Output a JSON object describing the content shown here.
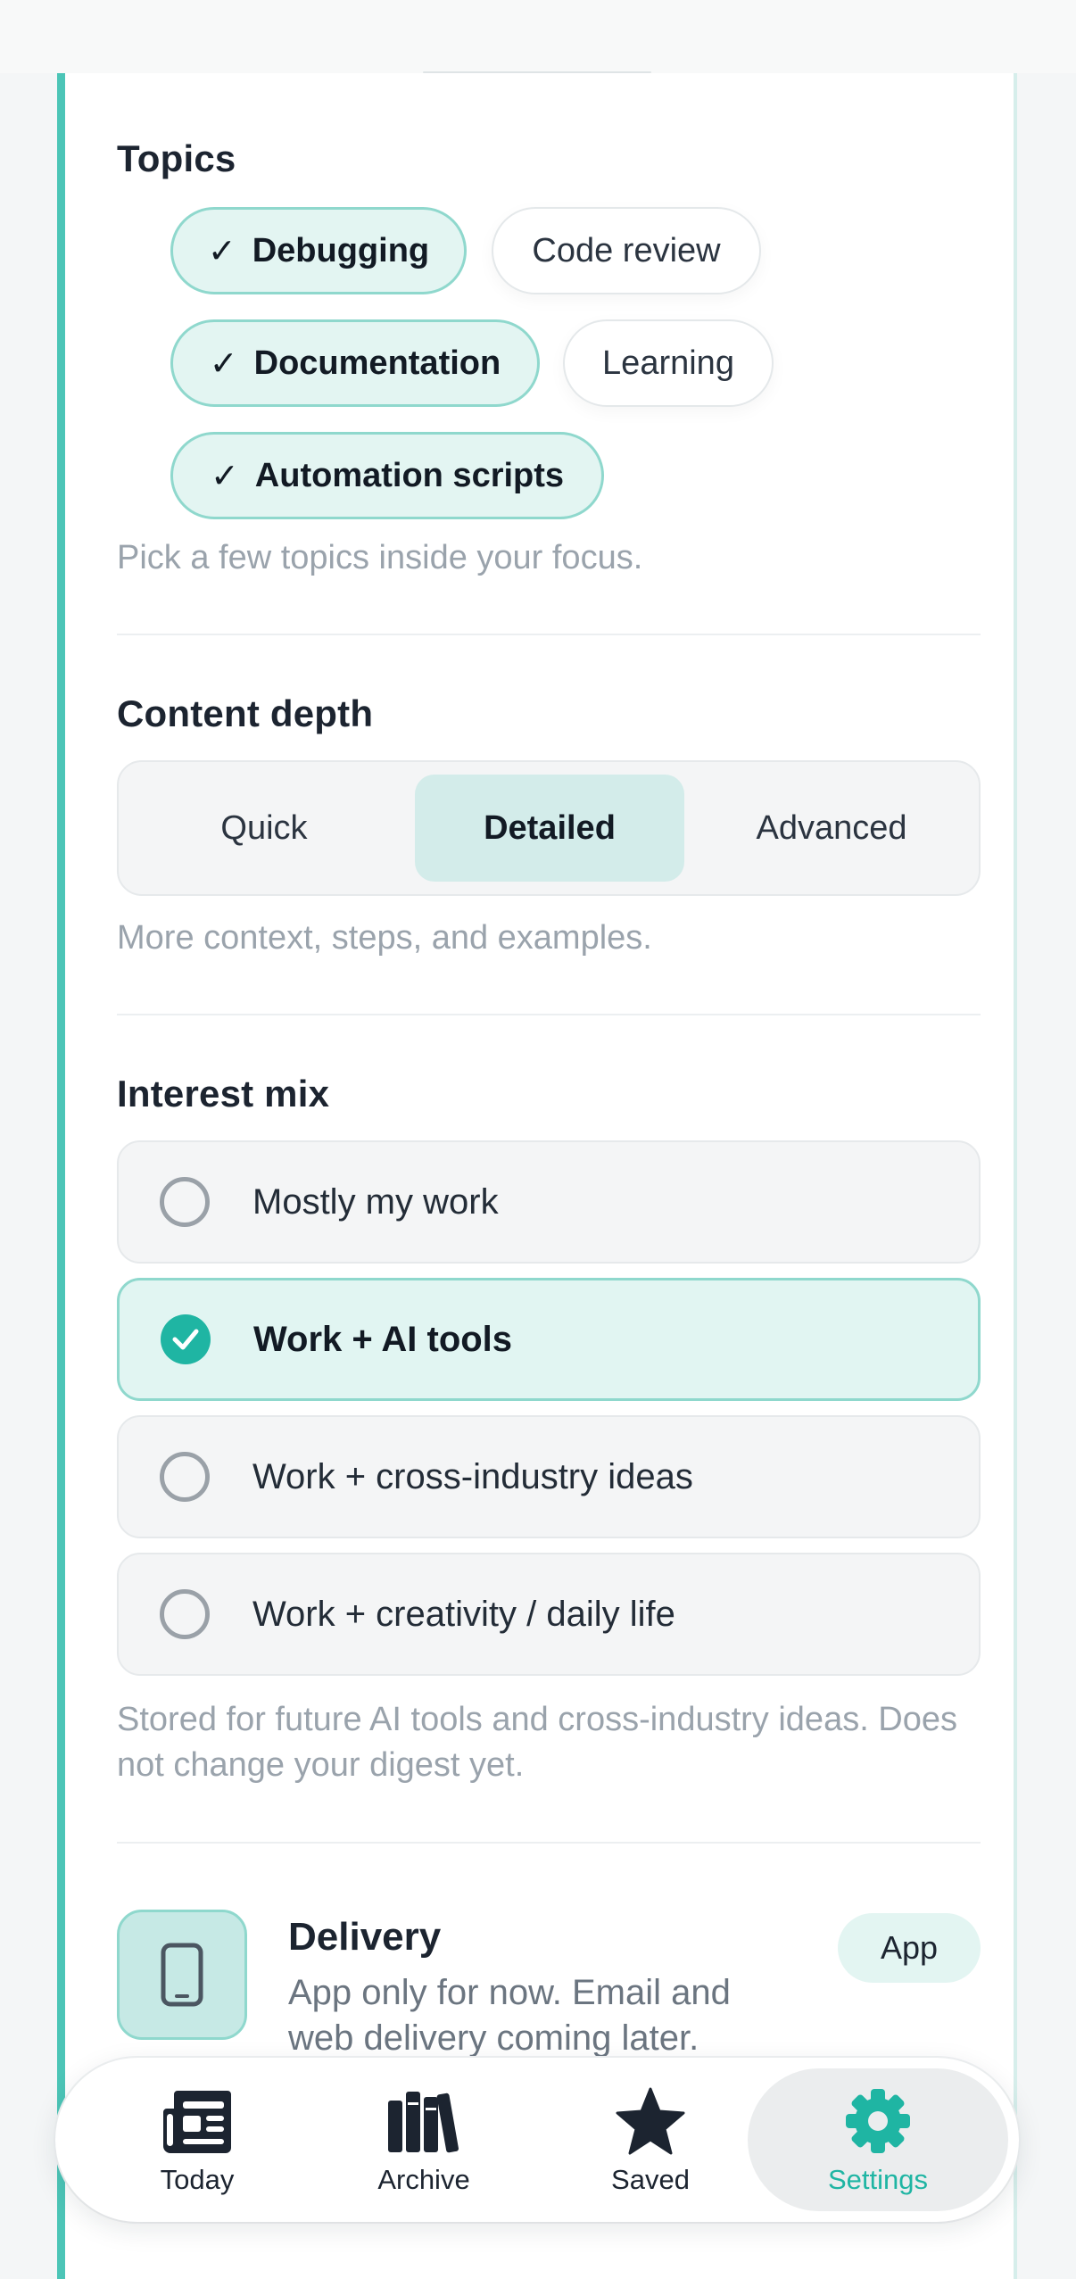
{
  "topics": {
    "title": "Topics",
    "chips": [
      {
        "label": "Debugging",
        "selected": true
      },
      {
        "label": "Code review",
        "selected": false
      },
      {
        "label": "Documentation",
        "selected": true
      },
      {
        "label": "Learning",
        "selected": false
      },
      {
        "label": "Automation scripts",
        "selected": true
      }
    ],
    "check_glyph": "✓",
    "helper": "Pick a few topics inside your focus."
  },
  "content_depth": {
    "title": "Content depth",
    "options": [
      "Quick",
      "Detailed",
      "Advanced"
    ],
    "selected": "Detailed",
    "helper": "More context, steps, and examples."
  },
  "interest_mix": {
    "title": "Interest mix",
    "options": [
      {
        "label": "Mostly my work",
        "selected": false
      },
      {
        "label": "Work + AI tools",
        "selected": true
      },
      {
        "label": "Work + cross-industry ideas",
        "selected": false
      },
      {
        "label": "Work + creativity / daily life",
        "selected": false
      }
    ],
    "helper": "Stored for future AI tools and cross-industry ideas. Does not change your digest yet."
  },
  "delivery": {
    "icon": "phone-icon",
    "title": "Delivery",
    "description": "App only for now. Email and web delivery coming later.",
    "badge": "App"
  },
  "tabbar": {
    "tabs": [
      {
        "label": "Today",
        "icon": "newspaper-icon"
      },
      {
        "label": "Archive",
        "icon": "books-icon"
      },
      {
        "label": "Saved",
        "icon": "star-icon"
      },
      {
        "label": "Settings",
        "icon": "gear-icon"
      }
    ],
    "active": "Settings"
  },
  "colors": {
    "accent": "#1fb5a3",
    "accent_light": "#e3f5f2",
    "accent_border": "#8fd8cd",
    "card_edge": "#4cc5b7"
  }
}
